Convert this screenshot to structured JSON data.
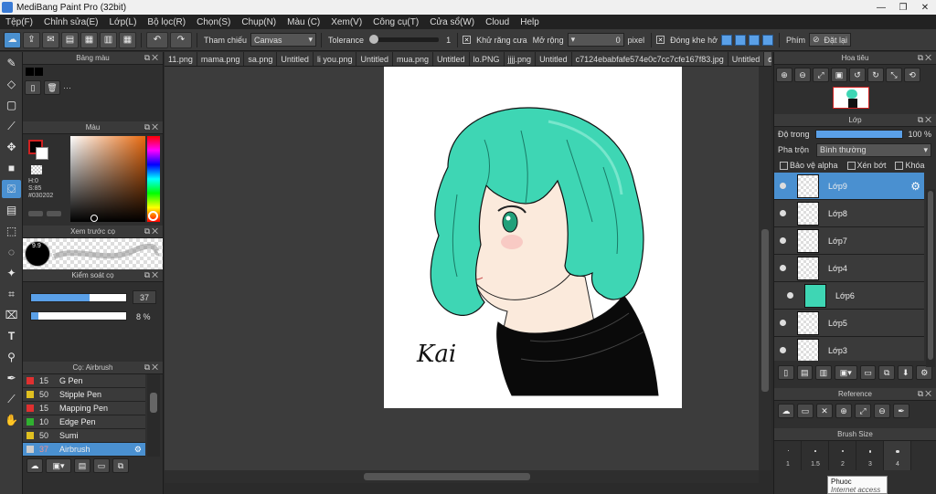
{
  "window": {
    "title": "MediBang Paint Pro (32bit)",
    "controls": [
      "—",
      "❐",
      "✕"
    ]
  },
  "menu": [
    "Tệp(F)",
    "Chỉnh sửa(E)",
    "Lớp(L)",
    "Bộ lọc(R)",
    "Chọn(S)",
    "Chụp(N)",
    "Màu (C)",
    "Xem(V)",
    "Công cụ(T)",
    "Cửa sổ(W)",
    "Cloud",
    "Help"
  ],
  "toolbar": {
    "reference_label": "Tham chiếu",
    "reference_value": "Canvas",
    "tolerance_label": "Tolerance",
    "tolerance_value": "1",
    "antialias_label": "Khử răng cưa",
    "expand_label": "Mở rộng",
    "expand_value": "0",
    "expand_unit": "pixel",
    "gap_close_label": "Đóng khe hở",
    "key_label": "Phím",
    "reset_label": "Đặt lại"
  },
  "palette_panel": {
    "title": "Bảng màu",
    "extra": "···"
  },
  "color_panel": {
    "title": "Màu",
    "primary_color": "#030202",
    "h": "H:0",
    "s": "S:85",
    "hex": "#030202"
  },
  "brush_preview_panel": {
    "title": "Xem trước cọ",
    "size": "9.9"
  },
  "brush_control_panel": {
    "title": "Kiểm soát cọ",
    "size_value": "37",
    "size_fraction": 0.62,
    "opacity_value": "8 %",
    "opacity_fraction": 0.08
  },
  "brush_list_panel": {
    "title": "Cọ: Airbrush",
    "items": [
      {
        "size": "15",
        "name": "G Pen",
        "color": "#e03030",
        "active": false
      },
      {
        "size": "50",
        "name": "Stipple Pen",
        "color": "#e0c020",
        "active": false
      },
      {
        "size": "15",
        "name": "Mapping Pen",
        "color": "#e03030",
        "active": false
      },
      {
        "size": "10",
        "name": "Edge Pen",
        "color": "#30b030",
        "active": false
      },
      {
        "size": "50",
        "name": "Sumi",
        "color": "#e0c020",
        "active": false
      },
      {
        "size": "37",
        "name": "Airbrush",
        "color": "#cccccc",
        "active": true
      }
    ]
  },
  "tabs": [
    "11.png",
    "mama.png",
    "sa.png",
    "Untitled",
    "li you.png",
    "Untitled",
    "mua.png",
    "Untitled",
    "lo.PNG",
    "jjjj.png",
    "Untitled",
    "c7124ebabfafe574e0c7cc7cfe167f83.jpg",
    "Untitled",
    "dow.png"
  ],
  "navigator_panel": {
    "title": "Hoa tiêu"
  },
  "layer_panel": {
    "title": "Lớp",
    "opacity_label": "Độ trong",
    "opacity_value": "100 %",
    "opacity_fraction": 1.0,
    "blend_label": "Pha trộn",
    "blend_value": "Bình thường",
    "protect_alpha": "Bảo vệ alpha",
    "clipping": "Xén bớt",
    "lock": "Khóa",
    "layers": [
      {
        "name": "Lớp9",
        "active": true,
        "indent": false
      },
      {
        "name": "Lớp8",
        "active": false,
        "indent": false
      },
      {
        "name": "Lớp7",
        "active": false,
        "indent": false
      },
      {
        "name": "Lớp4",
        "active": false,
        "indent": false
      },
      {
        "name": "Lớp6",
        "active": false,
        "indent": true
      },
      {
        "name": "Lớp5",
        "active": false,
        "indent": false
      },
      {
        "name": "Lớp3",
        "active": false,
        "indent": false
      }
    ]
  },
  "reference_panel": {
    "title": "Reference"
  },
  "brush_size_panel": {
    "title": "Brush Size",
    "sizes": [
      "1",
      "1.5",
      "2",
      "3",
      "4"
    ]
  },
  "tooltip": {
    "title": "Phuoc",
    "subtitle": "Internet access"
  },
  "signature": "Kai",
  "colors": {
    "accent": "#4a90d0",
    "hair": "#3ed6b4",
    "sweater": "#0a0a0a",
    "skin": "#fbeadc"
  }
}
